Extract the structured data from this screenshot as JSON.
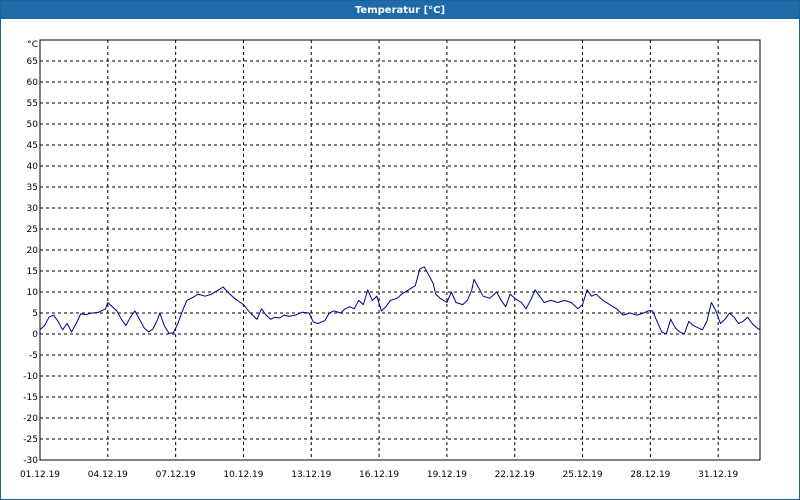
{
  "window": {
    "title": "Temperatur [°C]"
  },
  "chart_data": {
    "type": "line",
    "ylabel": "°C",
    "ylim": [
      -30,
      70
    ],
    "yticks": [
      65,
      60,
      55,
      50,
      45,
      40,
      35,
      30,
      25,
      20,
      15,
      10,
      5,
      0,
      -5,
      -10,
      -15,
      -20,
      -25,
      -30
    ],
    "xlim": [
      1,
      32.85
    ],
    "xticks": [
      {
        "day": 1,
        "label": "01.12.19"
      },
      {
        "day": 4,
        "label": "04.12.19"
      },
      {
        "day": 7,
        "label": "07.12.19"
      },
      {
        "day": 10,
        "label": "10.12.19"
      },
      {
        "day": 13,
        "label": "13.12.19"
      },
      {
        "day": 16,
        "label": "16.12.19"
      },
      {
        "day": 19,
        "label": "19.12.19"
      },
      {
        "day": 22,
        "label": "22.12.19"
      },
      {
        "day": 25,
        "label": "25.12.19"
      },
      {
        "day": 28,
        "label": "28.12.19"
      },
      {
        "day": 31,
        "label": "31.12.19"
      }
    ],
    "grid": true,
    "line_color": "#00008b",
    "series": [
      {
        "values": [
          [
            1.0,
            1.0
          ],
          [
            1.2,
            2.0
          ],
          [
            1.4,
            4.0
          ],
          [
            1.6,
            4.5
          ],
          [
            1.8,
            3.0
          ],
          [
            2.0,
            1.0
          ],
          [
            2.2,
            2.5
          ],
          [
            2.4,
            0.5
          ],
          [
            2.6,
            2.5
          ],
          [
            2.8,
            4.8
          ],
          [
            3.0,
            4.6
          ],
          [
            3.3,
            5.0
          ],
          [
            3.6,
            5.2
          ],
          [
            3.9,
            6.0
          ],
          [
            4.0,
            7.5
          ],
          [
            4.2,
            6.5
          ],
          [
            4.4,
            5.5
          ],
          [
            4.6,
            3.5
          ],
          [
            4.8,
            2.0
          ],
          [
            5.0,
            4.0
          ],
          [
            5.2,
            5.5
          ],
          [
            5.4,
            3.5
          ],
          [
            5.6,
            1.5
          ],
          [
            5.8,
            0.5
          ],
          [
            6.0,
            1.2
          ],
          [
            6.2,
            3.5
          ],
          [
            6.3,
            5.0
          ],
          [
            6.5,
            2.0
          ],
          [
            6.7,
            0.2
          ],
          [
            6.9,
            0.3
          ],
          [
            7.1,
            2.5
          ],
          [
            7.3,
            5.5
          ],
          [
            7.5,
            8.0
          ],
          [
            7.8,
            8.8
          ],
          [
            8.0,
            9.5
          ],
          [
            8.3,
            9.0
          ],
          [
            8.6,
            9.5
          ],
          [
            8.9,
            10.5
          ],
          [
            9.1,
            11.2
          ],
          [
            9.3,
            10.0
          ],
          [
            9.6,
            8.5
          ],
          [
            10.0,
            7.0
          ],
          [
            10.3,
            5.0
          ],
          [
            10.6,
            3.5
          ],
          [
            10.8,
            6.0
          ],
          [
            11.0,
            4.5
          ],
          [
            11.2,
            3.5
          ],
          [
            11.4,
            4.0
          ],
          [
            11.6,
            3.8
          ],
          [
            11.8,
            4.5
          ],
          [
            12.0,
            4.2
          ],
          [
            12.3,
            4.5
          ],
          [
            12.6,
            5.2
          ],
          [
            12.9,
            5.0
          ],
          [
            13.1,
            2.8
          ],
          [
            13.3,
            2.5
          ],
          [
            13.6,
            3.2
          ],
          [
            13.8,
            5.0
          ],
          [
            14.0,
            5.5
          ],
          [
            14.3,
            5.0
          ],
          [
            14.5,
            6.0
          ],
          [
            14.7,
            6.5
          ],
          [
            14.9,
            6.0
          ],
          [
            15.1,
            8.0
          ],
          [
            15.3,
            7.0
          ],
          [
            15.5,
            10.5
          ],
          [
            15.7,
            8.0
          ],
          [
            15.9,
            9.0
          ],
          [
            16.1,
            5.5
          ],
          [
            16.3,
            6.5
          ],
          [
            16.5,
            8.0
          ],
          [
            16.8,
            8.5
          ],
          [
            17.0,
            9.5
          ],
          [
            17.3,
            10.5
          ],
          [
            17.6,
            11.5
          ],
          [
            17.8,
            15.5
          ],
          [
            18.0,
            16.0
          ],
          [
            18.2,
            14.0
          ],
          [
            18.4,
            12.0
          ],
          [
            18.5,
            9.5
          ],
          [
            18.7,
            8.5
          ],
          [
            19.0,
            7.5
          ],
          [
            19.2,
            10.0
          ],
          [
            19.4,
            7.5
          ],
          [
            19.7,
            7.0
          ],
          [
            19.9,
            8.0
          ],
          [
            20.1,
            10.5
          ],
          [
            20.2,
            13.0
          ],
          [
            20.4,
            11.0
          ],
          [
            20.6,
            9.0
          ],
          [
            20.9,
            8.5
          ],
          [
            21.2,
            10.0
          ],
          [
            21.4,
            8.0
          ],
          [
            21.6,
            6.5
          ],
          [
            21.8,
            9.5
          ],
          [
            22.0,
            8.5
          ],
          [
            22.3,
            7.5
          ],
          [
            22.5,
            6.0
          ],
          [
            22.7,
            8.0
          ],
          [
            22.9,
            10.5
          ],
          [
            23.1,
            9.0
          ],
          [
            23.3,
            7.5
          ],
          [
            23.6,
            8.0
          ],
          [
            23.9,
            7.5
          ],
          [
            24.2,
            8.0
          ],
          [
            24.5,
            7.5
          ],
          [
            24.8,
            6.0
          ],
          [
            25.0,
            7.0
          ],
          [
            25.2,
            10.5
          ],
          [
            25.4,
            9.0
          ],
          [
            25.6,
            9.5
          ],
          [
            25.9,
            8.0
          ],
          [
            26.2,
            7.0
          ],
          [
            26.5,
            6.0
          ],
          [
            26.8,
            4.5
          ],
          [
            27.1,
            5.0
          ],
          [
            27.4,
            4.5
          ],
          [
            27.7,
            5.0
          ],
          [
            27.9,
            5.5
          ],
          [
            28.1,
            5.5
          ],
          [
            28.3,
            3.0
          ],
          [
            28.5,
            0.5
          ],
          [
            28.7,
            0.0
          ],
          [
            28.9,
            3.5
          ],
          [
            29.1,
            1.5
          ],
          [
            29.3,
            0.5
          ],
          [
            29.5,
            0.0
          ],
          [
            29.7,
            3.0
          ],
          [
            29.9,
            2.0
          ],
          [
            30.1,
            1.5
          ],
          [
            30.3,
            1.0
          ],
          [
            30.5,
            3.0
          ],
          [
            30.7,
            7.5
          ],
          [
            30.9,
            5.5
          ],
          [
            31.1,
            2.5
          ],
          [
            31.3,
            3.5
          ],
          [
            31.5,
            5.0
          ],
          [
            31.7,
            4.0
          ],
          [
            31.9,
            2.5
          ],
          [
            32.1,
            3.0
          ],
          [
            32.3,
            4.0
          ],
          [
            32.5,
            2.5
          ],
          [
            32.7,
            1.5
          ],
          [
            32.85,
            1.0
          ]
        ]
      }
    ]
  }
}
